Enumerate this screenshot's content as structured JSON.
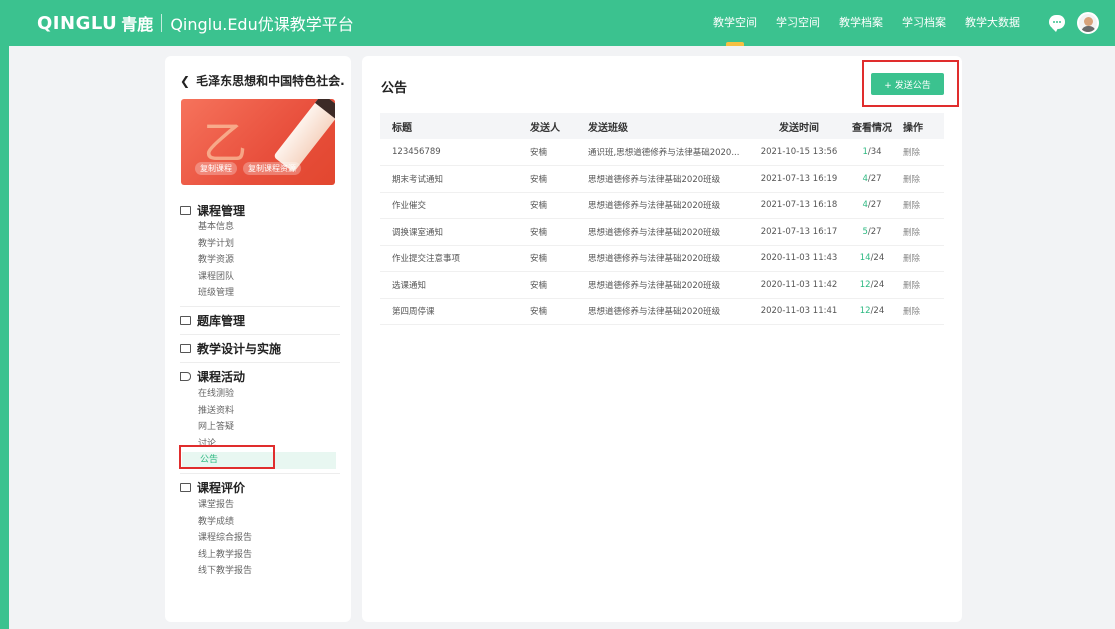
{
  "header": {
    "logo": "QINGLU",
    "logo_cn": "青鹿",
    "platform": "Qinglu.Edu优课教学平台",
    "nav": [
      "教学空间",
      "学习空间",
      "教学档案",
      "学习档案",
      "教学大数据"
    ],
    "active_nav": "教学空间"
  },
  "sidebar": {
    "course_title": "毛泽东思想和中国特色社会...",
    "cover_buttons": [
      "复制课程",
      "复制课程资源"
    ],
    "groups": [
      {
        "title": "课程管理",
        "items": [
          "基本信息",
          "教学计划",
          "教学资源",
          "课程团队",
          "班级管理"
        ]
      },
      {
        "title": "题库管理",
        "items": []
      },
      {
        "title": "教学设计与实施",
        "items": []
      },
      {
        "title": "课程活动",
        "items": [
          "在线测验",
          "推送资料",
          "网上答疑",
          "讨论",
          "公告"
        ]
      },
      {
        "title": "课程评价",
        "items": [
          "课堂报告",
          "教学成绩",
          "课程综合报告",
          "线上教学报告",
          "线下教学报告"
        ]
      }
    ],
    "active_item": "公告"
  },
  "main": {
    "title": "公告",
    "send_button": "+ 发送公告",
    "columns": [
      "标题",
      "发送人",
      "发送班级",
      "发送时间",
      "查看情况",
      "操作"
    ],
    "rows": [
      {
        "title": "123456789",
        "sender": "安楠",
        "class": "通识班,思想道德修养与法律基础2020...",
        "time": "2021-10-15 13:56",
        "viewed": "1",
        "total": "/34",
        "action": "删除"
      },
      {
        "title": "期末考试通知",
        "sender": "安楠",
        "class": "思想道德修养与法律基础2020班级",
        "time": "2021-07-13 16:19",
        "viewed": "4",
        "total": "/27",
        "action": "删除"
      },
      {
        "title": "作业催交",
        "sender": "安楠",
        "class": "思想道德修养与法律基础2020班级",
        "time": "2021-07-13 16:18",
        "viewed": "4",
        "total": "/27",
        "action": "删除"
      },
      {
        "title": "调换课室通知",
        "sender": "安楠",
        "class": "思想道德修养与法律基础2020班级",
        "time": "2021-07-13 16:17",
        "viewed": "5",
        "total": "/27",
        "action": "删除"
      },
      {
        "title": "作业提交注意事项",
        "sender": "安楠",
        "class": "思想道德修养与法律基础2020班级",
        "time": "2020-11-03 11:43",
        "viewed": "14",
        "total": "/24",
        "action": "删除"
      },
      {
        "title": "选课通知",
        "sender": "安楠",
        "class": "思想道德修养与法律基础2020班级",
        "time": "2020-11-03 11:42",
        "viewed": "12",
        "total": "/24",
        "action": "删除"
      },
      {
        "title": "第四周停课",
        "sender": "安楠",
        "class": "思想道德修养与法律基础2020班级",
        "time": "2020-11-03 11:41",
        "viewed": "12",
        "total": "/24",
        "action": "删除"
      }
    ]
  },
  "colors": {
    "brand": "#3bc28f",
    "accent_text": "#2db981",
    "highlight": "#e02d2d",
    "nav_indicator": "#f6c042"
  }
}
